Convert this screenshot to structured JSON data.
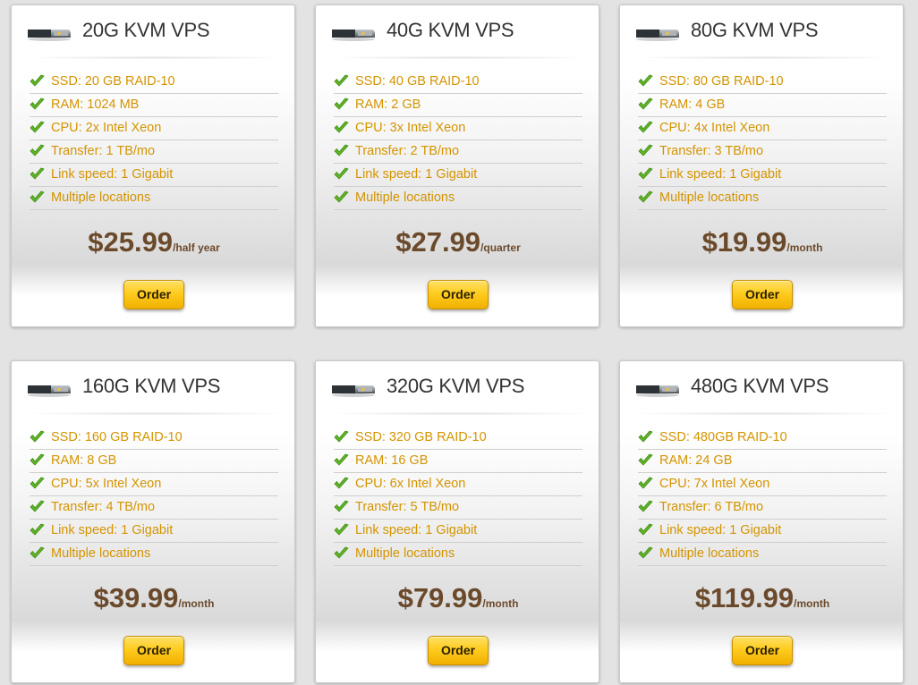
{
  "plans": [
    {
      "name": "20G KVM VPS",
      "features": [
        "SSD: 20 GB RAID-10",
        "RAM: 1024 MB",
        "CPU: 2x Intel Xeon",
        "Transfer: 1 TB/mo",
        "Link speed: 1 Gigabit",
        "Multiple locations"
      ],
      "price": "$25.99",
      "period": "/half year",
      "order_label": "Order"
    },
    {
      "name": "40G KVM VPS",
      "features": [
        "SSD: 40 GB RAID-10",
        "RAM: 2 GB",
        "CPU: 3x Intel Xeon",
        "Transfer: 2 TB/mo",
        "Link speed: 1 Gigabit",
        "Multiple locations"
      ],
      "price": "$27.99",
      "period": "/quarter",
      "order_label": "Order"
    },
    {
      "name": "80G KVM VPS",
      "features": [
        "SSD: 80 GB RAID-10",
        "RAM: 4 GB",
        "CPU: 4x Intel Xeon",
        "Transfer: 3 TB/mo",
        "Link speed: 1 Gigabit",
        "Multiple locations"
      ],
      "price": "$19.99",
      "period": "/month",
      "order_label": "Order"
    },
    {
      "name": "160G KVM VPS",
      "features": [
        "SSD: 160 GB RAID-10",
        "RAM: 8 GB",
        "CPU: 5x Intel Xeon",
        "Transfer: 4 TB/mo",
        "Link speed: 1 Gigabit",
        "Multiple locations"
      ],
      "price": "$39.99",
      "period": "/month",
      "order_label": "Order"
    },
    {
      "name": "320G KVM VPS",
      "features": [
        "SSD: 320 GB RAID-10",
        "RAM: 16 GB",
        "CPU: 6x Intel Xeon",
        "Transfer: 5 TB/mo",
        "Link speed: 1 Gigabit",
        "Multiple locations"
      ],
      "price": "$79.99",
      "period": "/month",
      "order_label": "Order"
    },
    {
      "name": "480G KVM VPS",
      "features": [
        "SSD: 480GB RAID-10",
        "RAM: 24 GB",
        "CPU: 7x Intel Xeon",
        "Transfer: 6 TB/mo",
        "Link speed: 1 Gigabit",
        "Multiple locations"
      ],
      "price": "$119.99",
      "period": "/month",
      "order_label": "Order"
    }
  ],
  "colors": {
    "page_background": "#e3e3e3",
    "feature_text": "#d49400",
    "price_text": "#6b4a2c",
    "check": "#5fb526",
    "order_button": "#ffcc1f"
  },
  "icons": {
    "plan": "server-icon",
    "feature": "check-icon"
  }
}
